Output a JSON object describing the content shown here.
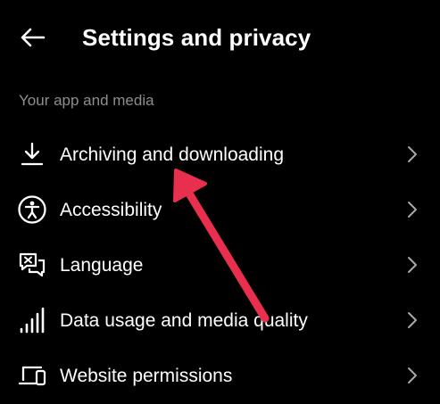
{
  "header": {
    "title": "Settings and privacy",
    "back_icon": "arrow-left-icon"
  },
  "section": {
    "title": "Your app and media"
  },
  "items": [
    {
      "label": "Archiving and downloading",
      "icon": "download-icon"
    },
    {
      "label": "Accessibility",
      "icon": "accessibility-icon"
    },
    {
      "label": "Language",
      "icon": "translate-icon"
    },
    {
      "label": "Data usage and media quality",
      "icon": "signal-bars-icon"
    },
    {
      "label": "Website permissions",
      "icon": "devices-icon"
    }
  ],
  "colors": {
    "background": "#000000",
    "text": "#ffffff",
    "secondary_text": "#8e8e8e",
    "chevron": "#a8a8a8",
    "annotation_arrow": "#e8304e"
  }
}
